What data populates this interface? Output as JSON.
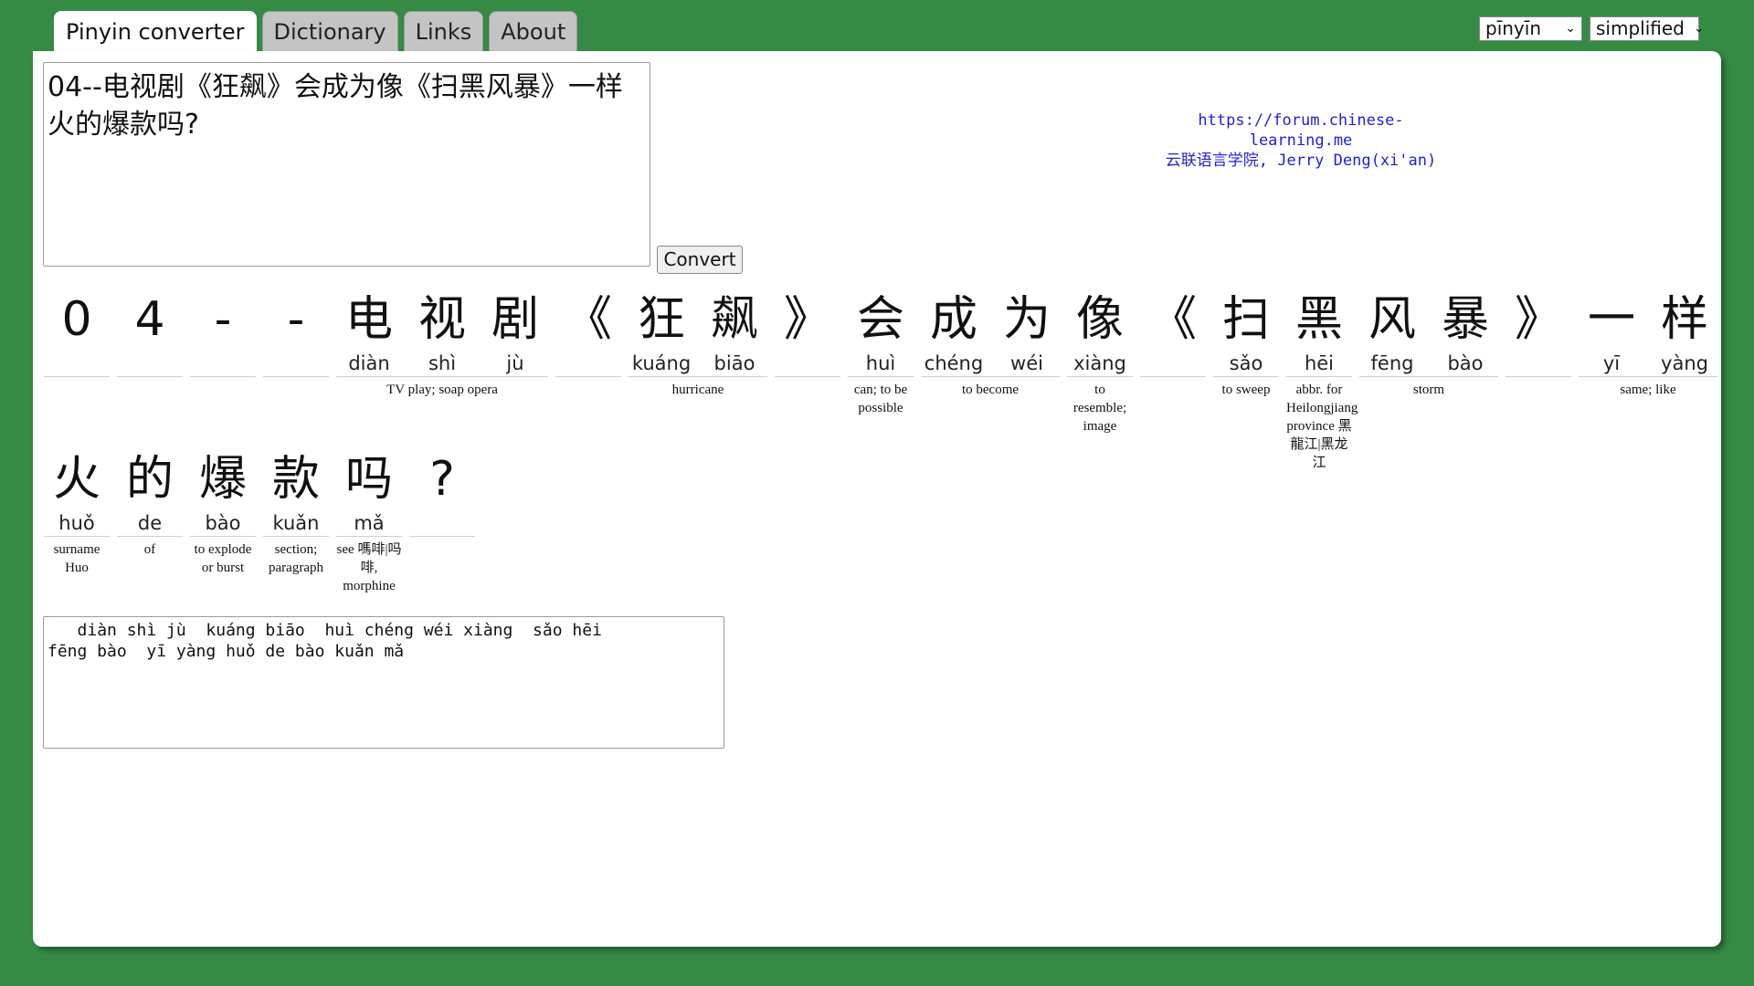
{
  "tabs": [
    {
      "label": "Pinyin converter",
      "active": true
    },
    {
      "label": "Dictionary",
      "active": false
    },
    {
      "label": "Links",
      "active": false
    },
    {
      "label": "About",
      "active": false
    }
  ],
  "selects": {
    "romanization": "pīnyīn",
    "script": "simplified"
  },
  "input": {
    "text": "04--电视剧《狂飙》会成为像《扫黑风暴》一样火的爆款吗?"
  },
  "convert_label": "Convert",
  "credit": {
    "line1": "https://forum.chinese-learning.me",
    "line2": "云联语言学院, Jerry Deng(xi'an)"
  },
  "row1": [
    {
      "chars": [
        {
          "hz": "0",
          "py": ""
        }
      ],
      "def": ""
    },
    {
      "chars": [
        {
          "hz": "4",
          "py": ""
        }
      ],
      "def": ""
    },
    {
      "chars": [
        {
          "hz": "-",
          "py": ""
        }
      ],
      "def": ""
    },
    {
      "chars": [
        {
          "hz": "-",
          "py": ""
        }
      ],
      "def": ""
    },
    {
      "chars": [
        {
          "hz": "电",
          "py": "diàn"
        },
        {
          "hz": "视",
          "py": "shì"
        },
        {
          "hz": "剧",
          "py": "jù"
        }
      ],
      "def": "TV play; soap opera"
    },
    {
      "chars": [
        {
          "hz": "《",
          "py": ""
        }
      ],
      "def": ""
    },
    {
      "chars": [
        {
          "hz": "狂",
          "py": "kuáng"
        },
        {
          "hz": "飙",
          "py": "biāo"
        }
      ],
      "def": "hurricane"
    },
    {
      "chars": [
        {
          "hz": "》",
          "py": ""
        }
      ],
      "def": ""
    },
    {
      "chars": [
        {
          "hz": "会",
          "py": "huì"
        }
      ],
      "def": "can; to be possible"
    },
    {
      "chars": [
        {
          "hz": "成",
          "py": "chéng"
        },
        {
          "hz": "为",
          "py": "wéi"
        }
      ],
      "def": "to become"
    },
    {
      "chars": [
        {
          "hz": "像",
          "py": "xiàng"
        }
      ],
      "def": "to resemble; image"
    },
    {
      "chars": [
        {
          "hz": "《",
          "py": ""
        }
      ],
      "def": ""
    },
    {
      "chars": [
        {
          "hz": "扫",
          "py": "sǎo"
        }
      ],
      "def": "to sweep"
    },
    {
      "chars": [
        {
          "hz": "黑",
          "py": "hēi"
        }
      ],
      "def": "abbr. for Heilongjiang province 黑龍江|黑龙江"
    },
    {
      "chars": [
        {
          "hz": "风",
          "py": "fēng"
        },
        {
          "hz": "暴",
          "py": "bào"
        }
      ],
      "def": "storm"
    },
    {
      "chars": [
        {
          "hz": "》",
          "py": ""
        }
      ],
      "def": ""
    },
    {
      "chars": [
        {
          "hz": "一",
          "py": "yī"
        },
        {
          "hz": "样",
          "py": "yàng"
        }
      ],
      "def": "same; like"
    }
  ],
  "row2": [
    {
      "chars": [
        {
          "hz": "火",
          "py": "huǒ"
        }
      ],
      "def": "surname Huo"
    },
    {
      "chars": [
        {
          "hz": "的",
          "py": "de"
        }
      ],
      "def": "of"
    },
    {
      "chars": [
        {
          "hz": "爆",
          "py": "bào"
        }
      ],
      "def": "to explode or burst"
    },
    {
      "chars": [
        {
          "hz": "款",
          "py": "kuǎn"
        }
      ],
      "def": "section; paragraph"
    },
    {
      "chars": [
        {
          "hz": "吗",
          "py": "mǎ"
        }
      ],
      "def": "see 嗎啡|吗啡, morphine"
    },
    {
      "chars": [
        {
          "hz": "?",
          "py": ""
        }
      ],
      "def": ""
    }
  ],
  "output": {
    "text": "   diàn shì jù  kuáng biāo  huì chéng wéi xiàng  sǎo hēi\nfēng bào  yī yàng huǒ de bào kuǎn mǎ"
  }
}
